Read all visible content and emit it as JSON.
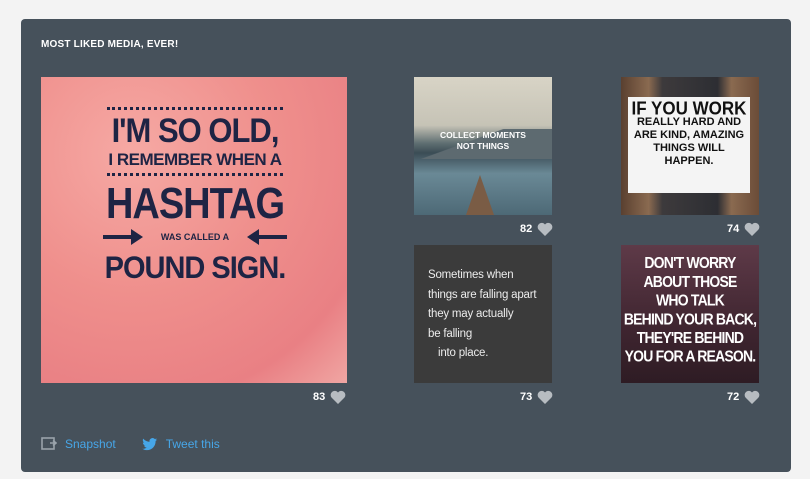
{
  "widget": {
    "title": "MOST LIKED MEDIA, EVER!"
  },
  "media": [
    {
      "likes": "83",
      "lines": [
        "I'M SO OLD,",
        "I REMEMBER WHEN A",
        "HASHTAG",
        "WAS CALLED A",
        "POUND SIGN."
      ]
    },
    {
      "likes": "82",
      "lines": [
        "COLLECT MOMENTS",
        "NOT THINGS"
      ]
    },
    {
      "likes": "74",
      "lines": [
        "IF YOU WORK",
        "REALLY HARD AND",
        "ARE KIND, AMAZING",
        "THINGS WILL HAPPEN."
      ]
    },
    {
      "likes": "73",
      "lines": [
        "Sometimes when",
        "things are falling apart",
        "they may actually",
        "be falling",
        "into place."
      ]
    },
    {
      "likes": "72",
      "lines": [
        "DON'T WORRY",
        "ABOUT THOSE",
        "WHO TALK",
        "BEHIND YOUR BACK,",
        "THEY'RE BEHIND",
        "YOU FOR A REASON."
      ]
    }
  ],
  "footer": {
    "snapshot_label": "Snapshot",
    "tweet_label": "Tweet this"
  },
  "colors": {
    "panel": "#46515b",
    "link": "#46a6e8",
    "heart": "#b7bcc1"
  },
  "icons": {
    "like": "heart-icon",
    "snapshot": "snapshot-icon",
    "tweet": "twitter-bird-icon"
  }
}
